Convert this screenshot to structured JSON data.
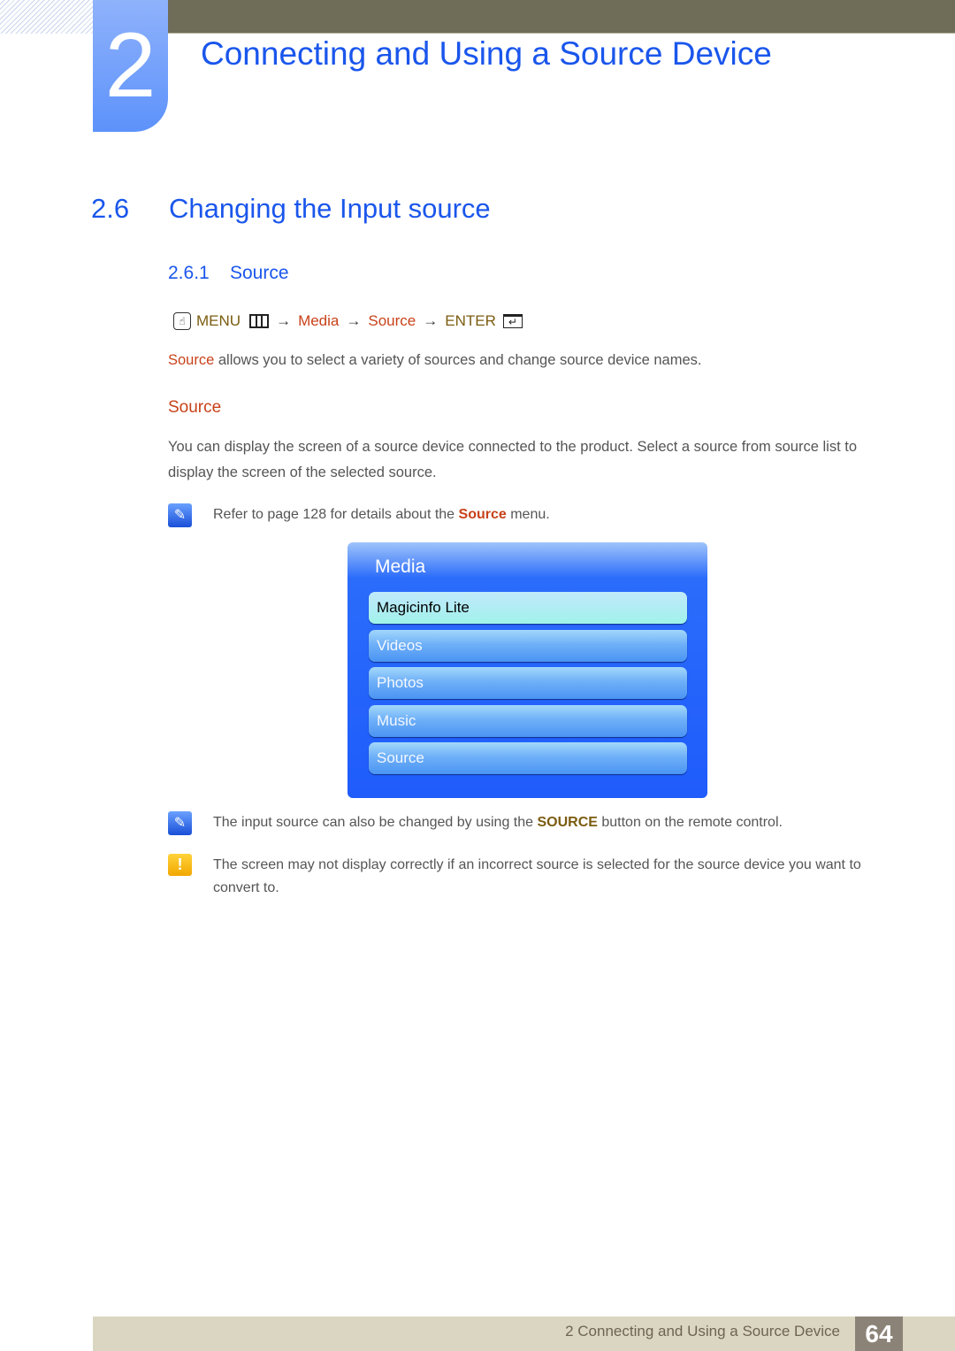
{
  "chapter": {
    "number": "2",
    "title": "Connecting and Using a Source Device"
  },
  "section": {
    "number": "2.6",
    "title": "Changing the Input source"
  },
  "subsection": {
    "number": "2.6.1",
    "title": "Source"
  },
  "menu_path": {
    "icon": "remote-hand-icon",
    "menu": "MENU",
    "menu_icon": "menu-grid-icon",
    "arrow": "→",
    "media": "Media",
    "source": "Source",
    "enter": "ENTER",
    "enter_icon": "enter-icon"
  },
  "intro": {
    "highlight": "Source",
    "text": " allows you to select a variety of sources and change source device names."
  },
  "source_heading": "Source",
  "body_paragraph": "You can display the screen of a source device connected to the product. Select a source from source list to display the screen of the selected source.",
  "note1": {
    "icon": "note-pencil-icon",
    "before": "Refer to page 128 for details about the ",
    "highlight": "Source",
    "after": " menu."
  },
  "tv_menu": {
    "title": "Media",
    "items": [
      {
        "label": "Magicinfo Lite",
        "selected": true
      },
      {
        "label": "Videos",
        "selected": false
      },
      {
        "label": "Photos",
        "selected": false
      },
      {
        "label": "Music",
        "selected": false
      },
      {
        "label": "Source",
        "selected": false
      }
    ]
  },
  "note2": {
    "icon": "note-pencil-icon",
    "before": "The input source can also be changed by using the ",
    "highlight": "SOURCE",
    "after": " button on the remote control."
  },
  "caution": {
    "icon": "warning-exclamation-icon",
    "symbol": "!",
    "text": "The screen may not display correctly if an incorrect source is selected for the source device you want to convert to."
  },
  "footer": {
    "text": "2 Connecting and Using a Source Device",
    "page": "64"
  },
  "colors": {
    "heading_blue": "#1a56ec",
    "highlight_orange": "#c8421a",
    "highlight_gold": "#7b5c10",
    "header_bar": "#6f6c58",
    "footer_bar": "#dbd6c2",
    "page_box": "#8c8378"
  }
}
